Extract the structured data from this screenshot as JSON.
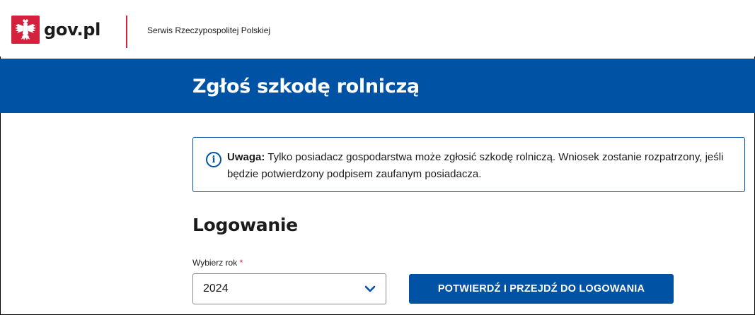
{
  "header": {
    "logo_text": "gov.pl",
    "service_name": "Serwis Rzeczypospolitej Polskiej",
    "brand_color": "#d4213d"
  },
  "banner": {
    "title": "Zgłoś szkodę rolniczą",
    "color": "#0052a5"
  },
  "alert": {
    "icon": "info-icon",
    "label": "Uwaga:",
    "text": " Tylko posiadacz gospodarstwa może zgłosić szkodę rolniczą. Wniosek zostanie rozpatrzony, jeśli będzie potwierdzony podpisem zaufanym posiadacza."
  },
  "login": {
    "title": "Logowanie",
    "year_label": "Wybierz rok",
    "required_mark": "*",
    "year_value": "2024",
    "confirm_button": "POTWIERDŹ I PRZEJDŹ DO LOGOWANIA"
  }
}
